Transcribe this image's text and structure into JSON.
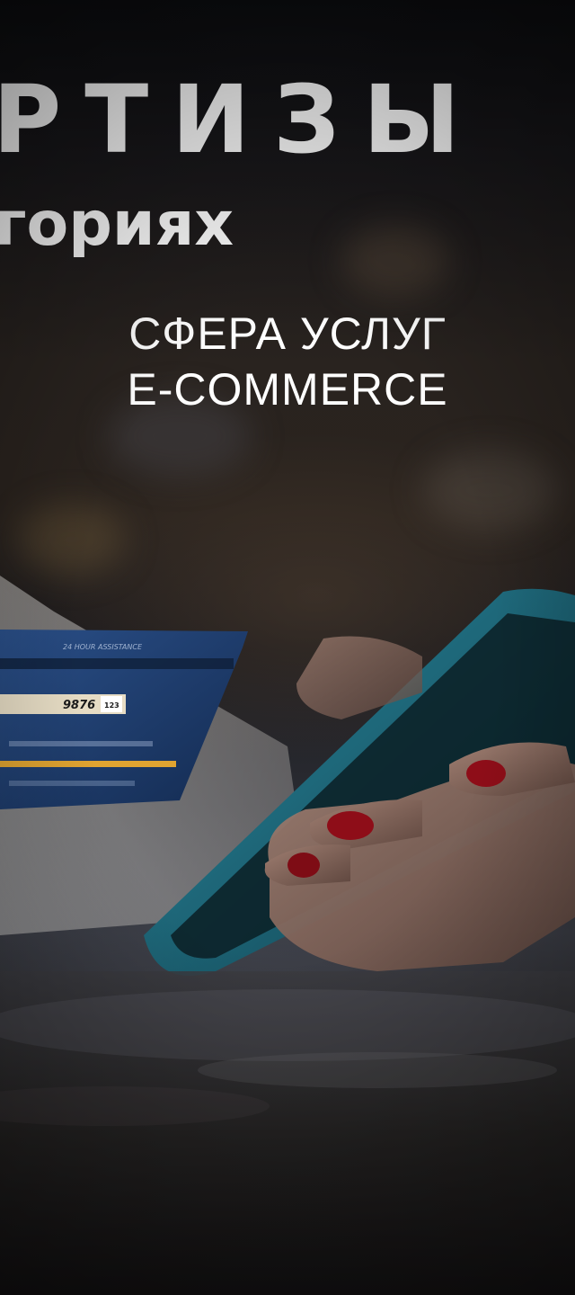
{
  "hero": {
    "headline": "РТИЗЫ",
    "subheadline": "гориях",
    "categories": [
      "СФЕРА УСЛУГ",
      "E-COMMERCE"
    ]
  },
  "card": {
    "top_text": "24 HOUR ASSISTANCE",
    "code": "9876",
    "code_small": "123"
  },
  "colors": {
    "text": "#ffffff",
    "card_blue": "#1b3a6b",
    "card_stripe": "#e0a431",
    "phone_teal": "#1e6f83",
    "nail_red": "#8e0d18"
  }
}
